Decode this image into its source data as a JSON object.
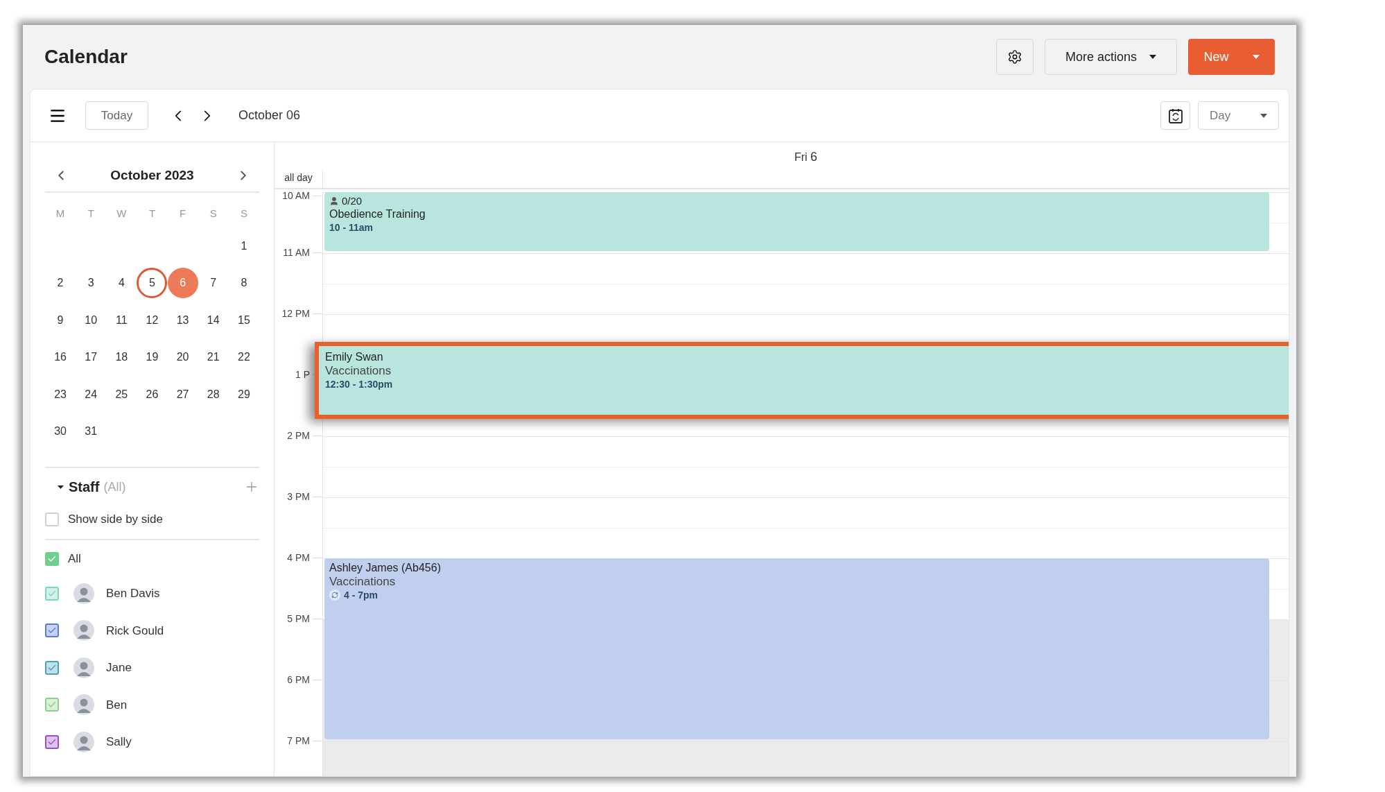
{
  "header": {
    "title": "Calendar",
    "buttons": [
      {
        "kind": "settings"
      },
      {
        "kind": "dropdown",
        "label": "More actions"
      },
      {
        "kind": "primary",
        "label": "New"
      }
    ]
  },
  "toolbar": {
    "today": "Today",
    "date": "October 06",
    "view": "Day"
  },
  "mini_calendar": {
    "title": "October 2023",
    "weekdays": [
      "M",
      "T",
      "W",
      "T",
      "F",
      "S",
      "S"
    ],
    "weeks": [
      {
        "days": [
          {
            "label": "1",
            "today": false,
            "selected": false
          }
        ]
      },
      {
        "days": [
          {
            "label": "2",
            "today": false,
            "selected": false
          },
          {
            "label": "3",
            "today": false,
            "selected": false
          },
          {
            "label": "4",
            "today": false,
            "selected": false
          },
          {
            "label": "5",
            "today": true,
            "selected": false
          },
          {
            "label": "6",
            "today": false,
            "selected": true
          },
          {
            "label": "7",
            "today": false,
            "selected": false
          },
          {
            "label": "8",
            "today": false,
            "selected": false
          }
        ]
      },
      {
        "days": [
          {
            "label": "9",
            "today": false,
            "selected": false
          },
          {
            "label": "10",
            "today": false,
            "selected": false
          },
          {
            "label": "11",
            "today": false,
            "selected": false
          },
          {
            "label": "12",
            "today": false,
            "selected": false
          },
          {
            "label": "13",
            "today": false,
            "selected": false
          },
          {
            "label": "14",
            "today": false,
            "selected": false
          },
          {
            "label": "15",
            "today": false,
            "selected": false
          }
        ]
      },
      {
        "days": [
          {
            "label": "16",
            "today": false,
            "selected": false
          },
          {
            "label": "17",
            "today": false,
            "selected": false
          },
          {
            "label": "18",
            "today": false,
            "selected": false
          },
          {
            "label": "19",
            "today": false,
            "selected": false
          },
          {
            "label": "20",
            "today": false,
            "selected": false
          },
          {
            "label": "21",
            "today": false,
            "selected": false
          },
          {
            "label": "22",
            "today": false,
            "selected": false
          }
        ]
      },
      {
        "days": [
          {
            "label": "23",
            "today": false,
            "selected": false
          },
          {
            "label": "24",
            "today": false,
            "selected": false
          },
          {
            "label": "25",
            "today": false,
            "selected": false
          },
          {
            "label": "26",
            "today": false,
            "selected": false
          },
          {
            "label": "27",
            "today": false,
            "selected": false
          },
          {
            "label": "28",
            "today": false,
            "selected": false
          },
          {
            "label": "29",
            "today": false,
            "selected": false
          }
        ]
      },
      {
        "days": [
          {
            "label": "30",
            "today": false,
            "selected": false
          },
          {
            "label": "31",
            "today": false,
            "selected": false
          }
        ]
      }
    ]
  },
  "staff": {
    "title": "Staff",
    "filter": "(All)",
    "expanded": true,
    "side_by_side": {
      "label": "Show side by side",
      "checked": false
    },
    "all": {
      "label": "All",
      "checked": true,
      "color": "#6fcf8f"
    },
    "members": [
      {
        "name": "Ben Davis",
        "checked": true,
        "color": "#7fd3c1"
      },
      {
        "name": "Rick Gould",
        "checked": true,
        "color": "#5b7bd5"
      },
      {
        "name": "Jane",
        "checked": true,
        "color": "#4aa3b8"
      },
      {
        "name": "Ben",
        "checked": true,
        "color": "#8ccf88"
      },
      {
        "name": "Sally",
        "checked": true,
        "color": "#9b4fc7"
      }
    ]
  },
  "day_view": {
    "day_name": "Fri",
    "day_number": "6",
    "all_day": "all day",
    "hours": [
      {
        "label": "10 AM",
        "after_hours": false
      },
      {
        "label": "11 AM",
        "after_hours": false
      },
      {
        "label": "12 PM",
        "after_hours": false
      },
      {
        "label": "1 P",
        "after_hours": false
      },
      {
        "label": "2 PM",
        "after_hours": false
      },
      {
        "label": "3 PM",
        "after_hours": false
      },
      {
        "label": "4 PM",
        "after_hours": false
      },
      {
        "label": "5 PM",
        "after_hours": true
      },
      {
        "label": "6 PM",
        "after_hours": true
      },
      {
        "label": "7 PM",
        "after_hours": true
      }
    ],
    "events": [
      {
        "kind": "class",
        "count": "0/20",
        "title": "Obedience Training",
        "time": "10 - 11am",
        "color": "#b8e6df",
        "highlighted": false,
        "recurring": false
      },
      {
        "kind": "appointment",
        "client": "Emily Swan",
        "title": "Vaccinations",
        "time": "12:30 - 1:30pm",
        "color": "#b8e6df",
        "highlighted": true,
        "recurring": false
      },
      {
        "kind": "appointment",
        "client": "Ashley James (Ab456)",
        "title": "Vaccinations",
        "time": "4 - 7pm",
        "color": "#c0cfee",
        "highlighted": false,
        "recurring": true
      }
    ]
  }
}
